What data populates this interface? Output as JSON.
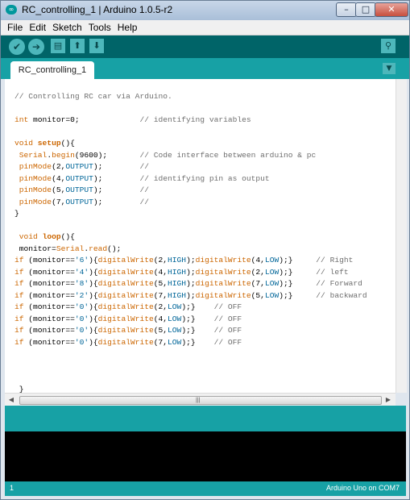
{
  "window": {
    "title": "RC_controlling_1 | Arduino 1.0.5-r2",
    "app_icon": "arduino-logo-icon",
    "app_icon_glyph": "∞",
    "controls": {
      "minimize": "–",
      "maximize": "□",
      "close": "✕"
    }
  },
  "menu": [
    "File",
    "Edit",
    "Sketch",
    "Tools",
    "Help"
  ],
  "toolbar": {
    "verify_icon": "✔",
    "upload_icon": "➔",
    "new_icon": "▤",
    "open_icon": "⬆",
    "save_icon": "⬇",
    "serial_monitor_icon": "⚲"
  },
  "tabs": [
    {
      "label": "RC_controlling_1"
    }
  ],
  "tab_menu_icon": "▼",
  "editor": {
    "code": [
      "// Controlling RC car via Arduino.",
      "",
      "int monitor=0;             // identifying variables",
      "",
      "void setup(){",
      " Serial.begin(9600);       // Code interface between arduino & pc",
      " pinMode(2,OUTPUT);        //",
      " pinMode(4,OUTPUT);        // identifying pin as output",
      " pinMode(5,OUTPUT);        //",
      " pinMode(7,OUTPUT);        //",
      "}",
      "",
      " void loop(){",
      " monitor=Serial.read();",
      "if (monitor=='6'){digitalWrite(2,HIGH);digitalWrite(4,LOW);}     // Right",
      "if (monitor=='4'){digitalWrite(4,HIGH);digitalWrite(2,LOW);}     // left",
      "if (monitor=='8'){digitalWrite(5,HIGH);digitalWrite(7,LOW);}     // Forward",
      "if (monitor=='2'){digitalWrite(7,HIGH);digitalWrite(5,LOW);}     // backward",
      "if (monitor=='0'){digitalWrite(2,LOW);}    // OFF",
      "if (monitor=='0'){digitalWrite(4,LOW);}    // OFF",
      "if (monitor=='0'){digitalWrite(5,LOW);}    // OFF",
      "if (monitor=='0'){digitalWrite(7,LOW);}    // OFF",
      "",
      "",
      "",
      " }"
    ],
    "horizontal_scroll_grip": "|||",
    "scroll_left_icon": "◀",
    "scroll_right_icon": "▶"
  },
  "status": {
    "line_number": "1",
    "board": "Arduino Uno on COM7"
  },
  "colors": {
    "toolbar": "#006468",
    "accent": "#17a1a5",
    "button": "#4db7bb",
    "console": "#000000",
    "keyword": "#cc6600",
    "constant": "#006699",
    "comment": "#6f6f6f"
  }
}
